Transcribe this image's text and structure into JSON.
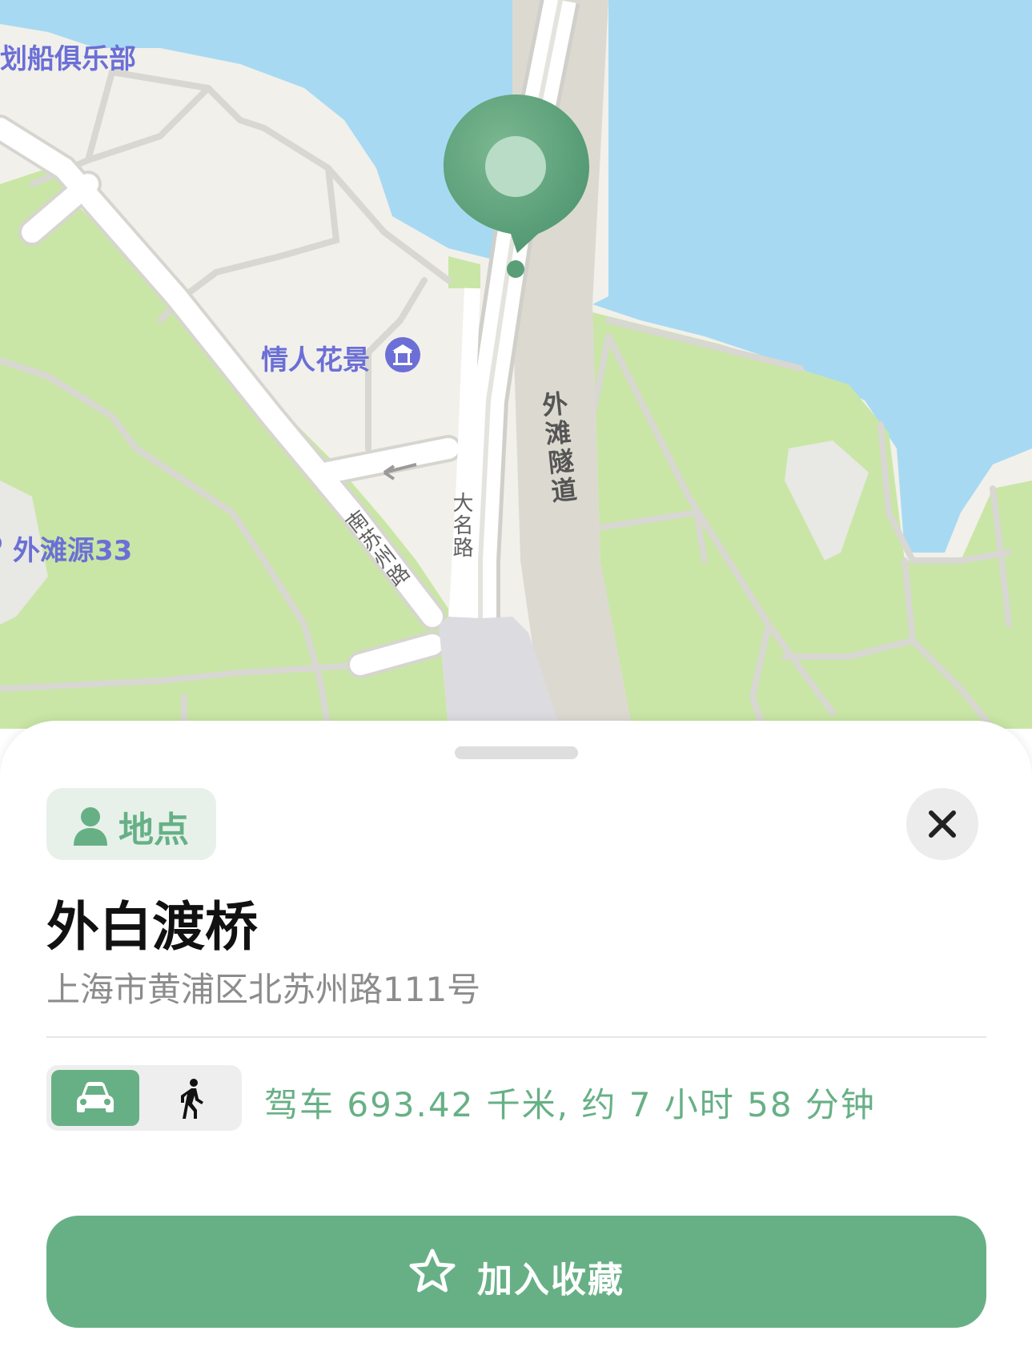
{
  "map": {
    "poi_labels": {
      "rowing_club": "划船俱乐部",
      "lovers_garden": "情人花景",
      "waitanyuan": "外滩源33"
    },
    "road_labels": {
      "tunnel": "外滩隧道",
      "south_suzhou_rd": "南苏州路",
      "daming_rd": "大名路"
    },
    "colors": {
      "water": "#a7daf2",
      "park": "#c9e6a6",
      "land": "#f2f0eb",
      "road": "#ffffff",
      "pin": "#5a9e77",
      "poi_text": "#6b6fd6"
    },
    "pin_icon": "map-pin-icon"
  },
  "sheet": {
    "category": {
      "icon": "person-icon",
      "label": "地点"
    },
    "close_icon": "close-icon",
    "title": "外白渡桥",
    "address": "上海市黄浦区北苏州路111号",
    "transport_modes": [
      {
        "icon": "car-icon",
        "selected": true
      },
      {
        "icon": "walk-icon",
        "selected": false
      }
    ],
    "route_summary": "驾车 693.42 千米, 约 7 小时 58 分钟",
    "favorite_button": {
      "icon": "star-icon",
      "label": "加入收藏"
    },
    "accent_color": "#67b086"
  }
}
